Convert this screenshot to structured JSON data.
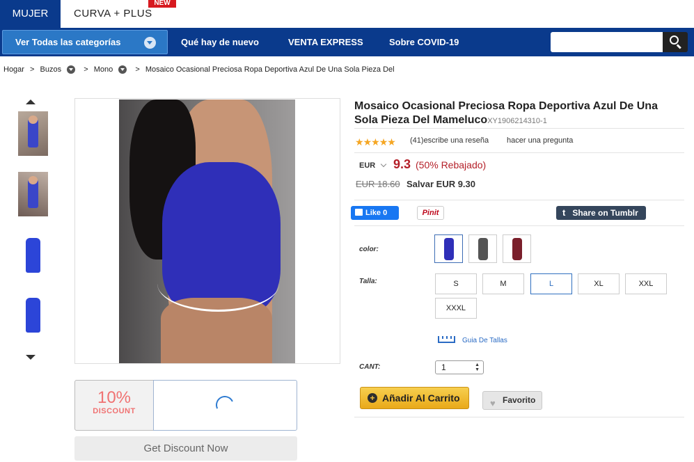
{
  "top_tabs": {
    "women": "MUJER",
    "curve_plus": "CURVA + PLUS",
    "new_badge": "NEW"
  },
  "nav": {
    "categories_button": "Ver Todas las categorías",
    "links": [
      "Qué hay de nuevo",
      "VENTA EXPRESS",
      "Sobre COVID-19"
    ],
    "search_placeholder": ""
  },
  "breadcrumb": {
    "home": "Hogar",
    "sep": ">",
    "cat1": "Buzos",
    "cat2": "Mono",
    "current": "Mosaico Ocasional Preciosa Ropa Deportiva Azul De Una Sola Pieza Del"
  },
  "gallery": {
    "thumb_count": 4,
    "main_image_alt": "blue one-piece sporty romper"
  },
  "discount": {
    "percent": "10%",
    "label": "DISCOUNT",
    "cta": "Get Discount Now"
  },
  "product": {
    "title": "Mosaico Ocasional Preciosa Ropa Deportiva Azul De Una Sola Pieza Del Mameluco",
    "sku": "XY1906214310-1",
    "rating_stars": 5,
    "reviews": "(41)",
    "write_review": "escribe una reseña",
    "ask_question": "hacer una pregunta",
    "currency": "EUR",
    "price": "9.3",
    "discount_text": "(50% Rebajado)",
    "old_price": "EUR 18.60",
    "save_text": "Salvar EUR 9.30"
  },
  "social": {
    "like": "Like",
    "like_count": "0",
    "pinit": "Pinit",
    "tumblr": "Share on Tumblr"
  },
  "options": {
    "color_label": "color:",
    "size_label": "Talla:",
    "colors": [
      "#2f2fb8",
      "#555555",
      "#7a1f2b"
    ],
    "sizes": [
      "S",
      "M",
      "L",
      "XL",
      "XXL",
      "XXXL"
    ],
    "selected_size": "L",
    "size_guide": "Guia De Tallas",
    "qty_label": "CANT:",
    "qty_value": "1"
  },
  "actions": {
    "add_to_cart": "Añadir Al Carrito",
    "favorite": "Favorito"
  },
  "colors": {
    "brand_blue": "#0a3a8c",
    "price_red": "#b41f28",
    "cart_yellow": "#f0bd33"
  }
}
